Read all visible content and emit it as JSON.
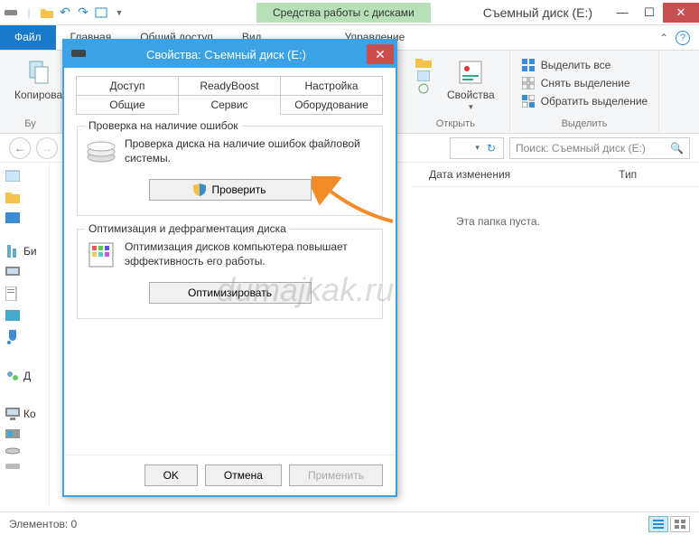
{
  "window": {
    "context_tab": "Средства работы с дисками",
    "title": "Съемный диск (E:)"
  },
  "tabs": {
    "file": "Файл",
    "home": "Главная",
    "share": "Общий доступ",
    "view": "Вид",
    "manage": "Управление"
  },
  "ribbon": {
    "copy_label": "Копирова",
    "group_clip": "Бу",
    "properties": "Свойства",
    "open_group": "Открыть",
    "select_all": "Выделить все",
    "clear_sel": "Снять выделение",
    "invert_sel": "Обратить выделение",
    "select_group": "Выделить"
  },
  "nav": {
    "search_placeholder": "Поиск: Съемный диск (E:)"
  },
  "columns": {
    "date": "Дата изменения",
    "type": "Тип"
  },
  "empty": "Эта папка пуста.",
  "status": {
    "elements": "Элементов: 0"
  },
  "sidebar": {
    "items": [
      "Би",
      "Д",
      "Ко"
    ]
  },
  "dialog": {
    "title": "Свойства: Съемный диск (E:)",
    "tabs_row1": [
      "Доступ",
      "ReadyBoost",
      "Настройка"
    ],
    "tabs_row2": [
      "Общие",
      "Сервис",
      "Оборудование"
    ],
    "active_tab": "Сервис",
    "check": {
      "legend": "Проверка на наличие ошибок",
      "text": "Проверка диска на наличие ошибок файловой системы.",
      "button": "Проверить"
    },
    "optimize": {
      "legend": "Оптимизация и дефрагментация диска",
      "text": "Оптимизация дисков компьютера повышает эффективность его работы.",
      "button": "Оптимизировать"
    },
    "ok": "OK",
    "cancel": "Отмена",
    "apply": "Применить"
  },
  "watermark": "dumajkak.ru"
}
